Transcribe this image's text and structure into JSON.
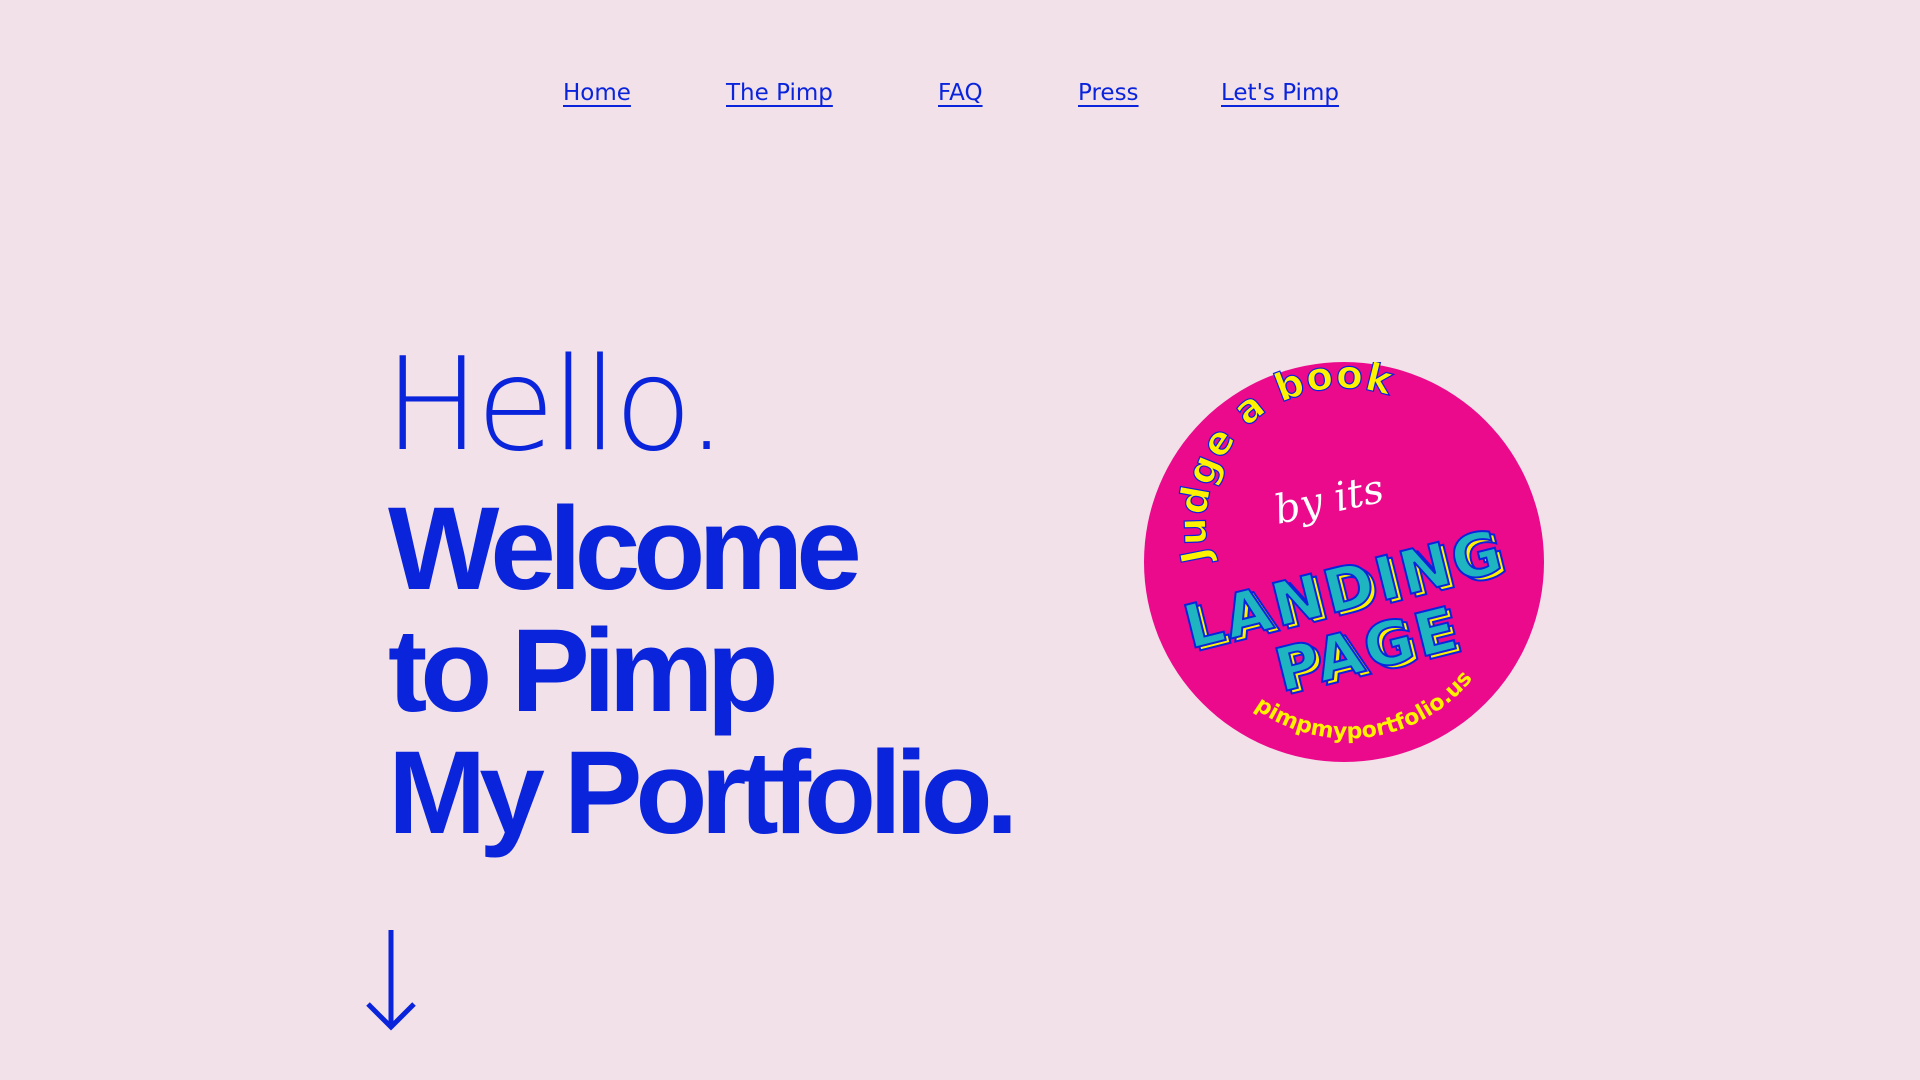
{
  "nav": {
    "items": [
      {
        "label": "Home"
      },
      {
        "label": "The Pimp"
      },
      {
        "label": "FAQ"
      },
      {
        "label": "Press"
      },
      {
        "label": "Let's Pimp"
      }
    ]
  },
  "hero": {
    "greeting": "Hello.",
    "headline": [
      "Welcome",
      "to Pimp",
      "My Portfolio."
    ],
    "scroll_icon": "arrow-down-icon"
  },
  "badge": {
    "top_text": "Judge a book",
    "middle_text": "by its",
    "line1": "LANDING",
    "line2": "PAGE",
    "url": "pimpmyportfolio.us",
    "colors": {
      "circle": "#eb0a8c",
      "arc_text": "#fff200",
      "block_text": "#1fb5c0",
      "script_text": "#ffffff"
    }
  },
  "colors": {
    "background": "#f2e1e8",
    "accent": "#0a24dc"
  }
}
